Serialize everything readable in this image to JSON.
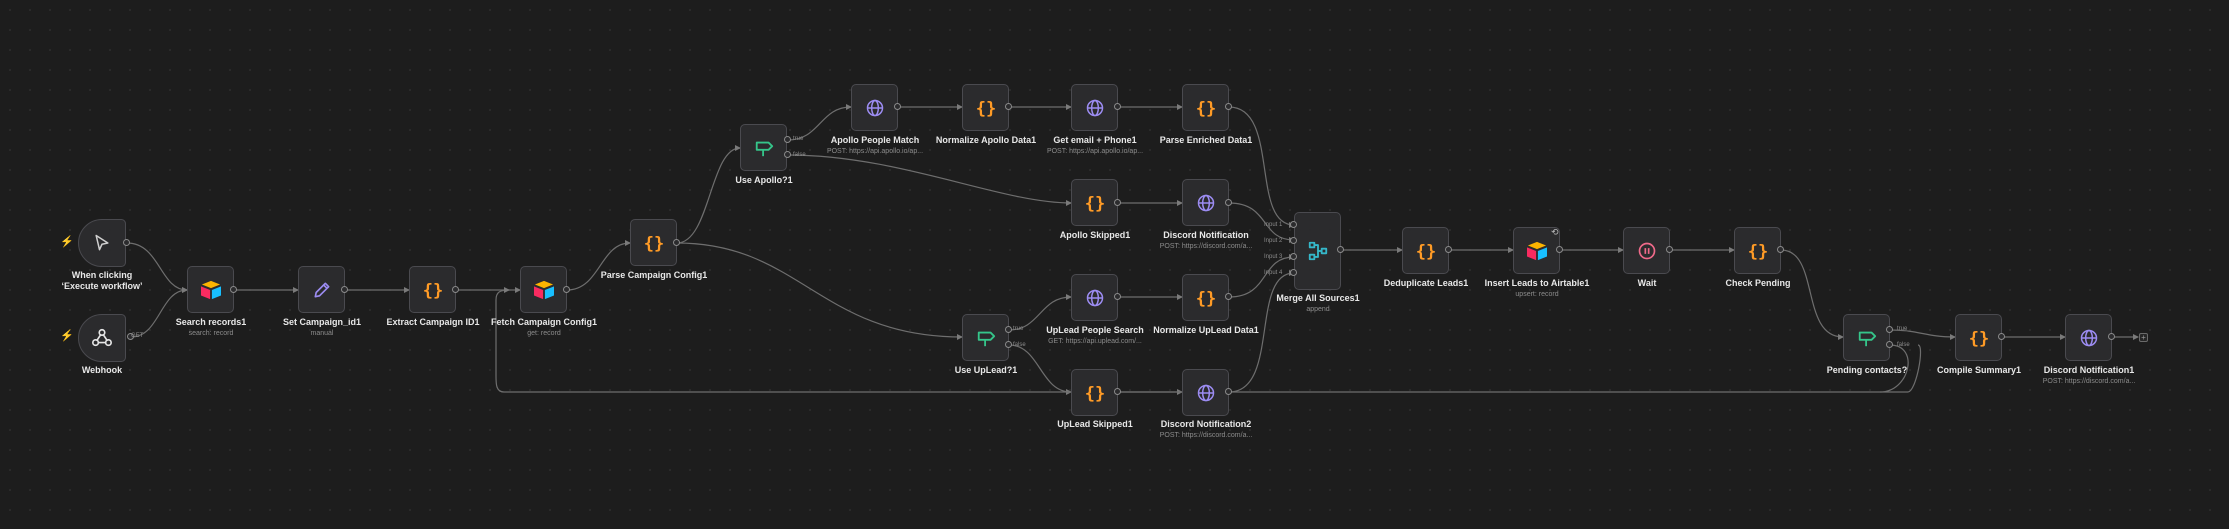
{
  "nodes": [
    {
      "id": "trigger",
      "label": "When clicking ‘Execute workflow’",
      "sub": "",
      "icon": "cursor-icon"
    },
    {
      "id": "webhook",
      "label": "Webhook",
      "sub": "",
      "icon": "webhook-icon"
    },
    {
      "id": "search",
      "label": "Search records1",
      "sub": "search: record",
      "icon": "airtable-icon"
    },
    {
      "id": "setcamp",
      "label": "Set Campaign_id1",
      "sub": "manual",
      "icon": "pencil-icon"
    },
    {
      "id": "extract",
      "label": "Extract Campaign ID1",
      "sub": "",
      "icon": "code-icon"
    },
    {
      "id": "fetch",
      "label": "Fetch Campaign Config1",
      "sub": "get: record",
      "icon": "airtable-icon"
    },
    {
      "id": "parsecfg",
      "label": "Parse Campaign Config1",
      "sub": "",
      "icon": "code-icon"
    },
    {
      "id": "useapollo",
      "label": "Use Apollo?1",
      "sub": "",
      "icon": "if-icon"
    },
    {
      "id": "apollomatch",
      "label": "Apollo People Match",
      "sub": "POST: https://api.apollo.io/ap...",
      "icon": "globe-icon"
    },
    {
      "id": "normapollo",
      "label": "Normalize Apollo Data1",
      "sub": "",
      "icon": "code-icon"
    },
    {
      "id": "getemail",
      "label": "Get email + Phone1",
      "sub": "POST: https://api.apollo.io/ap...",
      "icon": "globe-icon"
    },
    {
      "id": "parseenr",
      "label": "Parse Enriched Data1",
      "sub": "",
      "icon": "code-icon"
    },
    {
      "id": "apolloskip",
      "label": "Apollo Skipped1",
      "sub": "",
      "icon": "code-icon"
    },
    {
      "id": "discord1",
      "label": "Discord Notification",
      "sub": "POST: https://discord.com/a...",
      "icon": "globe-icon"
    },
    {
      "id": "useuplead",
      "label": "Use UpLead?1",
      "sub": "",
      "icon": "if-icon"
    },
    {
      "id": "upleadsearch",
      "label": "UpLead People Search",
      "sub": "GET: https://api.uplead.com/...",
      "icon": "globe-icon"
    },
    {
      "id": "normuplead",
      "label": "Normalize UpLead Data1",
      "sub": "",
      "icon": "code-icon"
    },
    {
      "id": "upleadskip",
      "label": "UpLead Skipped1",
      "sub": "",
      "icon": "code-icon"
    },
    {
      "id": "discord2",
      "label": "Discord Notification2",
      "sub": "POST: https://discord.com/a...",
      "icon": "globe-icon"
    },
    {
      "id": "merge",
      "label": "Merge All Sources1",
      "sub": "append",
      "icon": "merge-icon"
    },
    {
      "id": "dedup",
      "label": "Deduplicate Leads1",
      "sub": "",
      "icon": "code-icon"
    },
    {
      "id": "insert",
      "label": "Insert Leads to Airtable1",
      "sub": "upsert: record",
      "icon": "airtable-icon"
    },
    {
      "id": "wait",
      "label": "Wait",
      "sub": "",
      "icon": "pause-icon"
    },
    {
      "id": "checkpend",
      "label": "Check Pending",
      "sub": "",
      "icon": "code-icon"
    },
    {
      "id": "pending",
      "label": "Pending contacts?",
      "sub": "",
      "icon": "if-icon"
    },
    {
      "id": "compile",
      "label": "Compile Summary1",
      "sub": "",
      "icon": "code-icon"
    },
    {
      "id": "discord3",
      "label": "Discord Notification1",
      "sub": "POST: https://discord.com/a...",
      "icon": "globe-icon"
    }
  ],
  "port_labels": {
    "useapollo_true": "true",
    "useapollo_false": "false",
    "useuplead_true": "true",
    "useuplead_false": "false",
    "pending_true": "true",
    "pending_false": "false",
    "merge_in1": "Input 1",
    "merge_in2": "Input 2",
    "merge_in3": "Input 3",
    "merge_in4": "Input 4",
    "webhook_out": "GET"
  },
  "colors": {
    "accent_code": "#ff9b26",
    "accent_http": "#9c8cf2",
    "accent_if": "#35c58a",
    "accent_trigger": "#e05a44",
    "wire": "#6e6e6e"
  }
}
